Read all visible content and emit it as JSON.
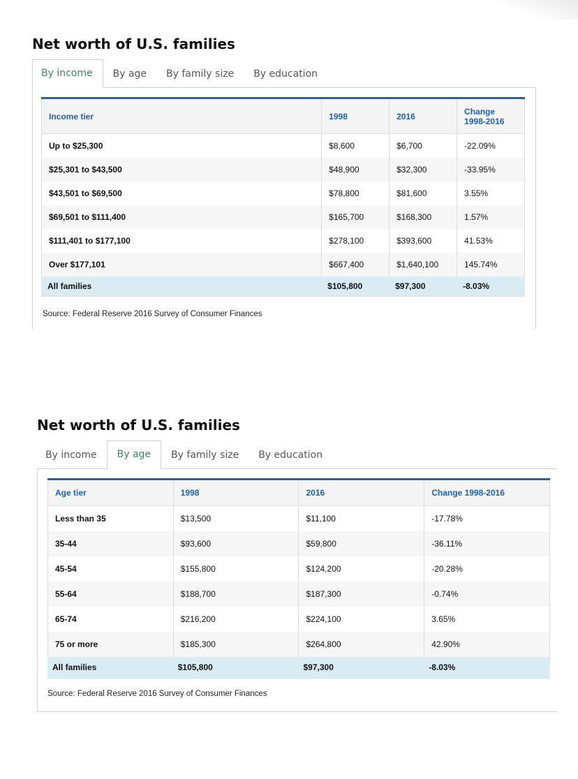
{
  "panels": [
    {
      "title": "Net worth of U.S. families",
      "tabs": [
        "By income",
        "By age",
        "By family size",
        "By education"
      ],
      "active_tab": 0,
      "headers": [
        "Income tier",
        "1998",
        "2016",
        "Change 1998-2016"
      ],
      "rows": [
        [
          "Up to $25,300",
          "$8,600",
          "$6,700",
          "-22.09%"
        ],
        [
          "$25,301 to $43,500",
          "$48,900",
          "$32,300",
          "-33.95%"
        ],
        [
          "$43,501 to $69,500",
          "$78,800",
          "$81,600",
          "3.55%"
        ],
        [
          "$69,501 to $111,400",
          "$165,700",
          "$168,300",
          "1.57%"
        ],
        [
          "$111,401 to $177,100",
          "$278,100",
          "$393,600",
          "41.53%"
        ],
        [
          "Over $177,101",
          "$667,400",
          "$1,640,100",
          "145.74%"
        ]
      ],
      "total": [
        "All families",
        "$105,800",
        "$97,300",
        "-8.03%"
      ],
      "source": "Source: Federal Reserve 2016 Survey of Consumer Finances"
    },
    {
      "title": "Net worth of U.S. families",
      "tabs": [
        "By income",
        "By age",
        "By family size",
        "By education"
      ],
      "active_tab": 1,
      "headers": [
        "Age tier",
        "1998",
        "2016",
        "Change 1998-2016"
      ],
      "rows": [
        [
          "Less than 35",
          "$13,500",
          "$11,100",
          "-17.78%"
        ],
        [
          "35-44",
          "$93,600",
          "$59,800",
          "-36.11%"
        ],
        [
          "45-54",
          "$155,800",
          "$124,200",
          "-20.28%"
        ],
        [
          "55-64",
          "$188,700",
          "$187,300",
          "-0.74%"
        ],
        [
          "65-74",
          "$216,200",
          "$224,100",
          "3.65%"
        ],
        [
          "75 or more",
          "$185,300",
          "$264,800",
          "42.90%"
        ]
      ],
      "total": [
        "All families",
        "$105,800",
        "$97,300",
        "-8.03%"
      ],
      "source": "Source: Federal Reserve 2016 Survey of Consumer Finances"
    }
  ]
}
